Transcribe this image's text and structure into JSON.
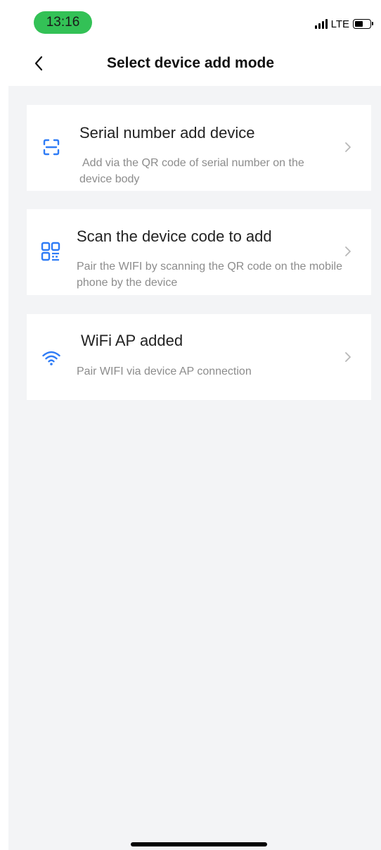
{
  "status_bar": {
    "time": "13:16",
    "network": "LTE",
    "signal_bars": 4,
    "battery_level": 0.55
  },
  "header": {
    "back_icon": "chevron-left-icon",
    "title": "Select device add mode"
  },
  "options": [
    {
      "icon": "scan-frame-icon",
      "title": "Serial number add device",
      "description": "Add via the QR code of serial number on the device body"
    },
    {
      "icon": "qr-code-icon",
      "title": "Scan the device code to add",
      "description": "Pair the WIFI by scanning the QR code on the mobile phone by the device"
    },
    {
      "icon": "wifi-icon",
      "title": "WiFi AP added",
      "description": "Pair WIFI via device AP connection"
    }
  ],
  "colors": {
    "accent": "#2f7cf6",
    "status_pill": "#33c156",
    "background": "#f3f4f6",
    "chevron": "#b8b8b8",
    "description": "#8c8c8c"
  }
}
